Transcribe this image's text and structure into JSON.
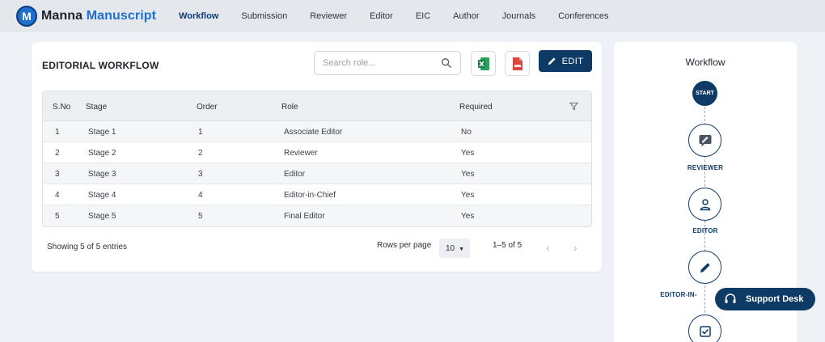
{
  "brand": {
    "part1": "Manna",
    "part2": "Manuscript",
    "logo_letter": "M"
  },
  "nav": [
    {
      "label": "Workflow",
      "active": true
    },
    {
      "label": "Submission"
    },
    {
      "label": "Reviewer"
    },
    {
      "label": "Editor"
    },
    {
      "label": "EIC"
    },
    {
      "label": "Author"
    },
    {
      "label": "Journals"
    },
    {
      "label": "Conferences"
    }
  ],
  "main": {
    "title": "EDITORIAL WORKFLOW",
    "search_placeholder": "Search role...",
    "edit_label": "EDIT",
    "columns": [
      "S.No",
      "Stage",
      "Order",
      "Role",
      "Required"
    ],
    "rows": [
      {
        "sno": "1",
        "stage": "Stage 1",
        "order": "1",
        "role": "Associate Editor",
        "required": "No"
      },
      {
        "sno": "2",
        "stage": "Stage 2",
        "order": "2",
        "role": "Reviewer",
        "required": "Yes"
      },
      {
        "sno": "3",
        "stage": "Stage 3",
        "order": "3",
        "role": "Editor",
        "required": "Yes"
      },
      {
        "sno": "4",
        "stage": "Stage 4",
        "order": "4",
        "role": "Editor-in-Chief",
        "required": "Yes"
      },
      {
        "sno": "5",
        "stage": "Stage 5",
        "order": "5",
        "role": "Final Editor",
        "required": "Yes"
      }
    ],
    "entries_text": "Showing 5 of 5 entries",
    "rows_per_page_label": "Rows per page",
    "rows_per_page_value": "10",
    "range_text": "1–5 of 5"
  },
  "workflow": {
    "title": "Workflow",
    "start_label": "START",
    "steps": [
      "REVIEWER",
      "EDITOR",
      "EDITOR-IN-"
    ]
  },
  "support": {
    "label": "Support Desk"
  },
  "colors": {
    "primary": "#0e3b66",
    "brand_blue": "#1f6fd1",
    "excel": "#1d7a45",
    "pdf": "#d8473d"
  }
}
